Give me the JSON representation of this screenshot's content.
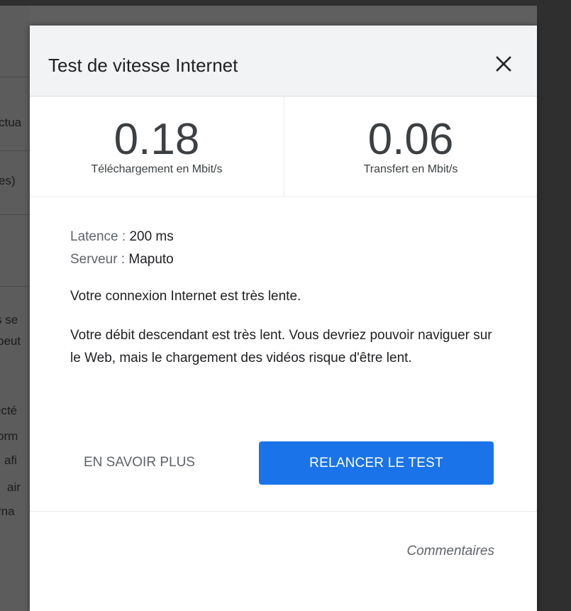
{
  "background_fragments": [
    {
      "text": "ctua"
    },
    {
      "text": "es)"
    },
    {
      "text": "s se"
    },
    {
      "text": "peut"
    },
    {
      "text": "ecté"
    },
    {
      "text": "orm"
    },
    {
      "text": "afi"
    },
    {
      "text": "air"
    },
    {
      "text": "rna"
    }
  ],
  "dialog": {
    "title": "Test de vitesse Internet",
    "close_icon": "close-icon",
    "download": {
      "value": "0.18",
      "label": "Téléchargement en Mbit/s"
    },
    "upload": {
      "value": "0.06",
      "label": "Transfert en Mbit/s"
    },
    "latency": {
      "key": "Latence : ",
      "value": "200 ms"
    },
    "server": {
      "key": "Serveur : ",
      "value": "Maputo"
    },
    "status_text": "Votre connexion Internet est très lente.",
    "description": "Votre débit descendant est très lent. Vous devriez pouvoir naviguer sur le Web, mais le chargement des vidéos risque d'être lent.",
    "learn_more_label": "EN SAVOIR PLUS",
    "rerun_label": "RELANCER LE TEST",
    "feedback_label": "Commentaires"
  },
  "colors": {
    "primary": "#1a73e8",
    "header_bg": "#f1f3f4",
    "text": "#202124",
    "muted": "#5f6368"
  }
}
